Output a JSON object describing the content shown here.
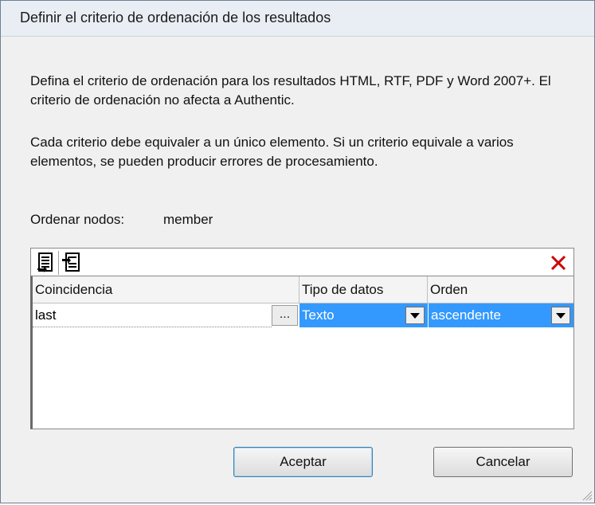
{
  "dialog": {
    "title": "Definir el criterio de ordenación de los resultados",
    "description_1": "Defina el criterio de ordenación para los resultados HTML, RTF, PDF y Word 2007+. El criterio de ordenación no afecta a Authentic.",
    "description_2": "Cada criterio debe equivaler a un único elemento. Si un criterio equivale a varios elementos, se pueden producir errores de procesamiento.",
    "sort_nodes_label": "Ordenar nodos:",
    "sort_nodes_value": "member"
  },
  "toolbar": {
    "icons": [
      "append-row-icon",
      "insert-row-icon",
      "delete-row-icon"
    ]
  },
  "grid": {
    "headers": [
      "Coincidencia",
      "Tipo de datos",
      "Orden"
    ],
    "rows": [
      {
        "match": "last",
        "match_button": "...",
        "data_type": "Texto",
        "order": "ascendente"
      }
    ]
  },
  "buttons": {
    "ok": "Aceptar",
    "cancel": "Cancelar"
  },
  "colors": {
    "selection": "#3399ff",
    "delete_icon": "#cc0000"
  }
}
